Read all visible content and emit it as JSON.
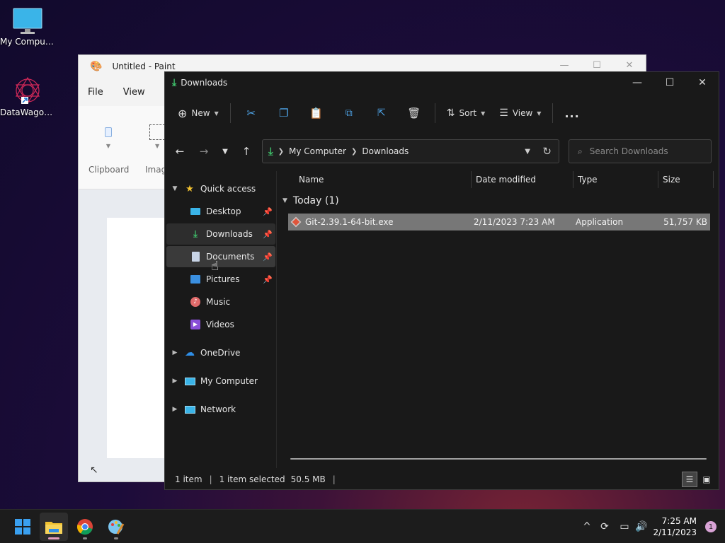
{
  "desktop": {
    "icons": [
      {
        "label": "My Computer"
      },
      {
        "label": "DataWagon..."
      }
    ]
  },
  "paint": {
    "title": "Untitled - Paint",
    "menu": {
      "file": "File",
      "view": "View"
    },
    "ribbon": {
      "clipboard": "Clipboard",
      "image": "Imag"
    }
  },
  "explorer": {
    "title": "Downloads",
    "toolbar": {
      "new": "New",
      "sort": "Sort",
      "view": "View",
      "more": "..."
    },
    "address": {
      "root": "My Computer",
      "current": "Downloads"
    },
    "search_placeholder": "Search Downloads",
    "nav": {
      "quick_access": "Quick access",
      "desktop": "Desktop",
      "downloads": "Downloads",
      "documents": "Documents",
      "pictures": "Pictures",
      "music": "Music",
      "videos": "Videos",
      "onedrive": "OneDrive",
      "my_computer": "My Computer",
      "network": "Network"
    },
    "columns": {
      "name": "Name",
      "date": "Date modified",
      "type": "Type",
      "size": "Size"
    },
    "group": "Today (1)",
    "files": [
      {
        "name": "Git-2.39.1-64-bit.exe",
        "date": "2/11/2023 7:23 AM",
        "type": "Application",
        "size": "51,757 KB"
      }
    ],
    "status": {
      "count": "1 item",
      "selected": "1 item selected",
      "size": "50.5 MB"
    }
  },
  "taskbar": {
    "time": "7:25 AM",
    "date": "2/11/2023",
    "notifications": "1"
  },
  "colors": {
    "accent_download": "#3fbf6a",
    "folder": "#f2c230",
    "row_selected": "#777777"
  }
}
